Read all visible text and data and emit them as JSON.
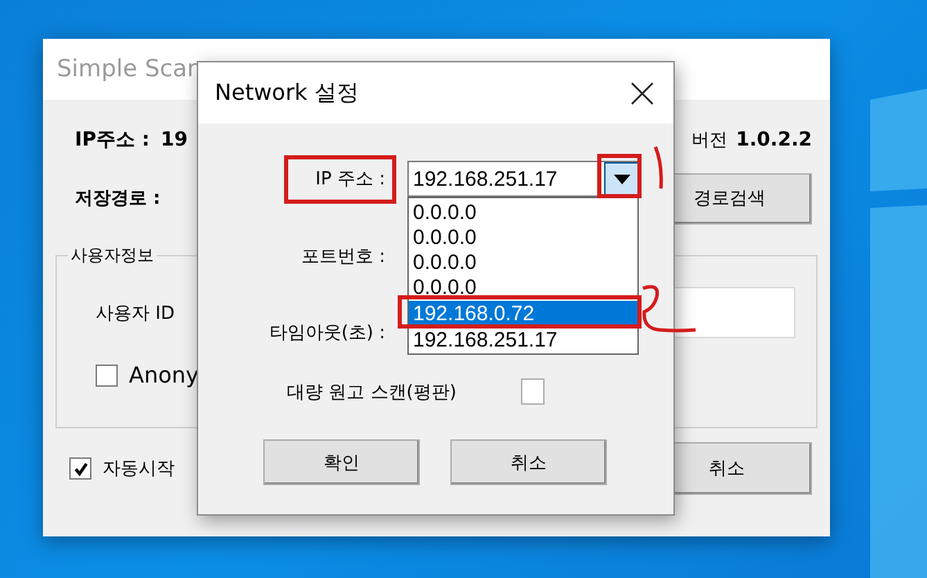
{
  "main_window": {
    "title": "Simple Scan",
    "ip_label": "IP주소 :",
    "ip_value": "19",
    "version_label": "버전",
    "version": "1.0.2.2",
    "path_label": "저장경로 :",
    "browse_button": "경로검색",
    "user_group": {
      "title": "사용자정보",
      "user_id_label": "사용자 ID",
      "anonymous": {
        "label": "Anony",
        "checked": false
      }
    },
    "autostart": {
      "label": "자동시작",
      "checked": true
    },
    "cancel_button": "취소"
  },
  "dialog": {
    "title": "Network 설정",
    "ip_label": "IP 주소 :",
    "ip_value": "192.168.251.17",
    "dropdown": {
      "expanded": true,
      "options": [
        {
          "label": "0.0.0.0",
          "selected": false
        },
        {
          "label": "0.0.0.0",
          "selected": false
        },
        {
          "label": "0.0.0.0",
          "selected": false
        },
        {
          "label": "0.0.0.0",
          "selected": false
        },
        {
          "label": "192.168.0.72",
          "selected": true
        },
        {
          "label": "192.168.251.17",
          "selected": false
        }
      ]
    },
    "port_label": "포트번호 :",
    "timeout_label": "타임아웃(초) :",
    "bulk_scan": {
      "label": "대량 원고 스캔(평판)",
      "checked": false
    },
    "buttons": [
      "확인",
      "취소"
    ]
  }
}
